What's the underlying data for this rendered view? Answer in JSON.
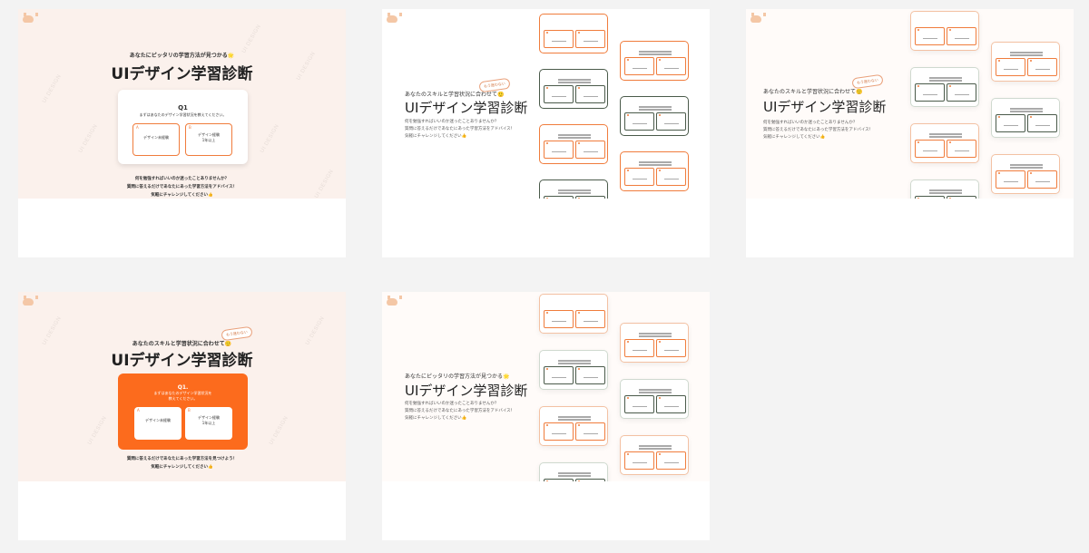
{
  "frame1": {
    "subtitle": "あなたにピッタリの学習方法が見つかる🌟",
    "title": "UIデザイン学習診断",
    "question_number": "Q1",
    "question_text": "まずはあなたのデザイン学習状況を教えてください。",
    "option_a_num": "A",
    "option_a": "デザイン未経験",
    "option_b_num": "B",
    "option_b": "デザイン経験\n1年以上",
    "desc": "何を勉強すればいいのか迷ったことありませんか？\n質問に答えるだけであなたにあった学習方法をアドバイス！\n気軽にチャレンジしてください👍",
    "watermark": "UI DESIGN"
  },
  "frame2": {
    "badge": "もう迷わない",
    "subtitle": "あなたのスキルと学習状況に合わせて🙂",
    "title": "UIデザイン学習診断",
    "desc": "何を勉強すればいいのか迷ったことありませんか？\n質問に答えるだけであなたにあった学習方法をアドバイス！\n気軽にチャレンジしてください👍"
  },
  "frame3": {
    "badge": "もう迷わない",
    "subtitle": "あなたのスキルと学習状況に合わせて🙂",
    "title": "UIデザイン学習診断",
    "desc": "何を勉強すればいいのか迷ったことありませんか？\n質問に答えるだけであなたにあった学習方法をアドバイス！\n気軽にチャレンジしてください👍"
  },
  "frame4": {
    "badge": "もう迷わない",
    "subtitle": "あなたのスキルと学習状況に合わせて🙂",
    "title": "UIデザイン学習診断",
    "question_number": "Q1.",
    "question_text": "まずはあなたのデザイン学習状況を\n教えてください。",
    "option_a_num": "A",
    "option_a": "デザイン未経験",
    "option_b_num": "B",
    "option_b": "デザイン経験\n1年以上",
    "desc": "質問に答えるだけであなたにあった学習方法を見つけよう！\n気軽にチャレンジしてください👍",
    "watermark": "UI DESIGN"
  },
  "frame5": {
    "subtitle": "あなたにピッタリの学習方法が見つかる🌟",
    "title": "UIデザイン学習診断",
    "desc": "何を勉強すればいいのか迷ったことありませんか？\n質問に答えるだけであなたにあった学習方法をアドバイス！\n気軽にチャレンジしてください👍"
  },
  "mini_card_label": "Q1.",
  "colors": {
    "accent": "#fc6b1d",
    "accent_border": "#f07c3c",
    "green_border": "#4a5a4a",
    "bg_peach": "#fbf1ec"
  }
}
